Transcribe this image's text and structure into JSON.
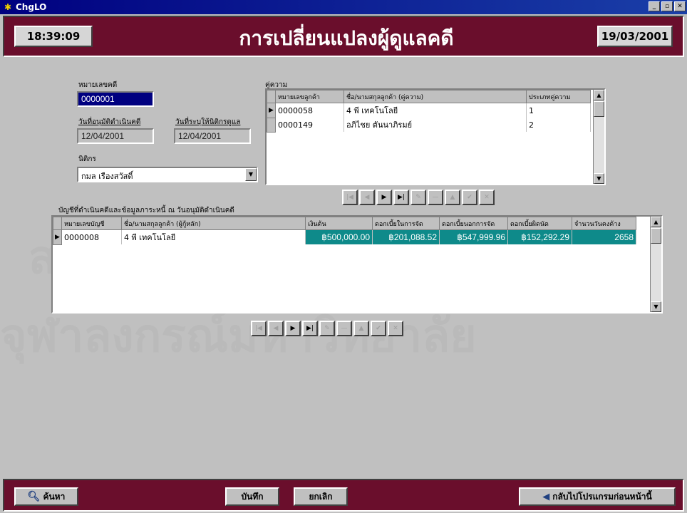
{
  "window": {
    "title": "ChgLO",
    "min": "_",
    "max": "▫",
    "close": "✕"
  },
  "header": {
    "time": "18:39:09",
    "heading": "การเปลี่ยนแปลงผู้ดูแลคดี",
    "date": "19/03/2001"
  },
  "form": {
    "case_no_label": "หมายเลขคดี",
    "case_no_value": "0000001",
    "approve_date_label": "วันที่อนุมัติดำเนินคดี",
    "approve_date_value": "12/04/2001",
    "court_date_label": "วันที่ระบุให้นิติกรดูแล",
    "court_date_value": "12/04/2001",
    "officer_label": "นิติกร",
    "officer_value": "กมล เรืองสวัสดิ์"
  },
  "parties": {
    "label": "คู่ความ",
    "columns": [
      "หมายเลขลูกค้า",
      "ชื่อ/นามสกุลลูกค้า (คู่ความ)",
      "ประเภทคู่ความ"
    ],
    "rows": [
      {
        "indicator": "▶",
        "cells": [
          "0000058",
          "4 พี เทคโนโลยี",
          "1"
        ]
      },
      {
        "indicator": "",
        "cells": [
          "0000149",
          "อภิไชย ตันนาภิรมย์",
          "2"
        ]
      }
    ]
  },
  "accounts": {
    "label": "บัญชีที่ดำเนินคดีและข้อมูลภาระหนี้ ณ วันอนุมัติดำเนินคดี",
    "columns": [
      "หมายเลขบัญชี",
      "ชื่อ/นามสกุลลูกค้า (ผู้กู้หลัก)",
      "เงินต้น",
      "ดอกเบี้ยในการจัด",
      "ดอกเบี้ยนอกการจัด",
      "ดอกเบี้ยผิดนัด",
      "จำนวนวันคงค้าง"
    ],
    "rows": [
      {
        "indicator": "▶",
        "cells": [
          "0000008",
          "4 พี เทคโนโลยี",
          "฿500,000.00",
          "฿201,088.52",
          "฿547,999.96",
          "฿152,292.29",
          "2658"
        ]
      }
    ]
  },
  "nav": [
    "|◀",
    "◀",
    "▶",
    "▶|",
    "✎",
    "—",
    "▲",
    "✔",
    "✕"
  ],
  "buttons": {
    "search": "ค้นหา",
    "search_icon": "magnifier-icon",
    "save": "บันทึก",
    "cancel": "ยกเลิก",
    "back": "กลับไปโปรแกรมก่อนหน้านี้",
    "back_icon": "back-arrow-icon"
  },
  "colors": {
    "maroon": "#6a0e2c",
    "teal": "#0e8a8a",
    "titlebar": "#000080"
  }
}
